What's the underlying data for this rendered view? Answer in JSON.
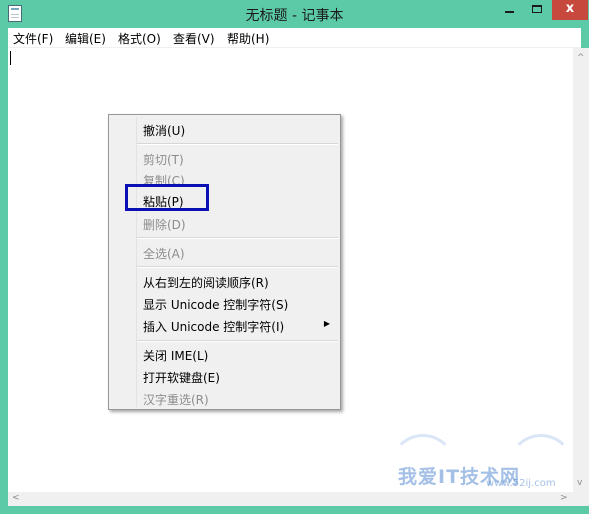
{
  "window": {
    "title": "无标题 - 记事本",
    "close_glyph": "x",
    "accent": "#5ccaa6",
    "close_color": "#c7483d"
  },
  "menu": {
    "file": "文件(F)",
    "edit": "编辑(E)",
    "format": "格式(O)",
    "view": "查看(V)",
    "help": "帮助(H)"
  },
  "context_menu": {
    "undo": "撤消(U)",
    "cut": "剪切(T)",
    "copy": "复制(C)",
    "paste": "粘贴(P)",
    "delete": "删除(D)",
    "select_all": "全选(A)",
    "rtl": "从右到左的阅读顺序(R)",
    "show_unicode": "显示 Unicode 控制字符(S)",
    "insert_unicode": "插入 Unicode 控制字符(I)",
    "submenu_arrow": "▶",
    "close_ime": "关闭 IME(L)",
    "open_keyboard": "打开软键盘(E)",
    "reconvert": "汉字重选(R)",
    "highlight_color": "#0a10b3"
  },
  "watermark": {
    "text": "我爱IT技术网",
    "url": "www.52ij.com"
  },
  "scroll_arrows": {
    "up": "^",
    "down": "v",
    "left": "<",
    "right": ">"
  }
}
